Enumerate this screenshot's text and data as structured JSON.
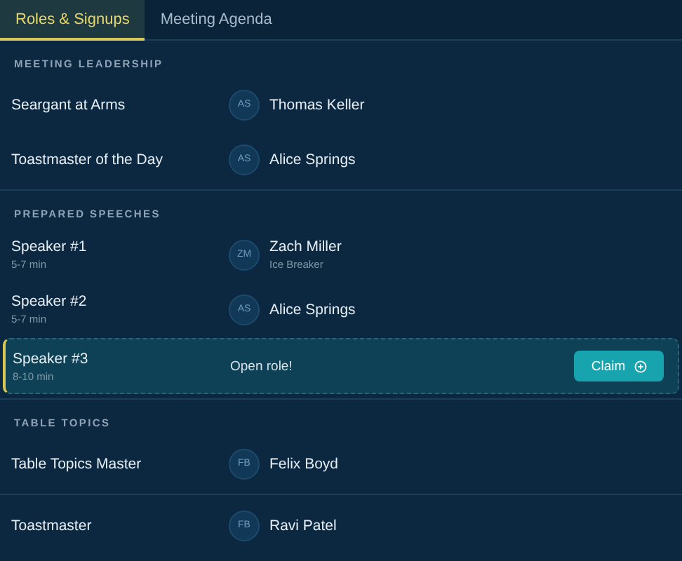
{
  "tabs": [
    {
      "label": "Roles & Signups",
      "selected": true
    },
    {
      "label": "Meeting Agenda",
      "selected": false
    }
  ],
  "sections": [
    {
      "heading": "MEETING LEADERSHIP",
      "roles": [
        {
          "kind": "assigned",
          "role": "Seargant at Arms",
          "initials": "AS",
          "member": "Thomas Keller"
        },
        {
          "kind": "assigned",
          "role": "Toastmaster of the Day",
          "initials": "AS",
          "member": "Alice Springs"
        }
      ]
    },
    {
      "heading": "PREPARED SPEECHES",
      "roles": [
        {
          "kind": "assigned",
          "role": "Speaker #1",
          "duration": "5-7 min",
          "initials": "ZM",
          "member": "Zach Miller",
          "speech": "Ice Breaker"
        },
        {
          "kind": "assigned",
          "role": "Speaker #2",
          "duration": "5-7 min",
          "initials": "AS",
          "member": "Alice Springs"
        },
        {
          "kind": "open",
          "role": "Speaker #3",
          "duration": "8-10 min",
          "status": "Open role!",
          "action": "Claim"
        }
      ]
    },
    {
      "heading": "TABLE TOPICS",
      "roles": [
        {
          "kind": "assigned",
          "role": "Table Topics Master",
          "initials": "FB",
          "member": "Felix Boyd"
        }
      ]
    },
    {
      "roles": [
        {
          "kind": "assigned",
          "role": "Toastmaster",
          "initials": "FB",
          "member": "Ravi Patel"
        }
      ]
    }
  ]
}
